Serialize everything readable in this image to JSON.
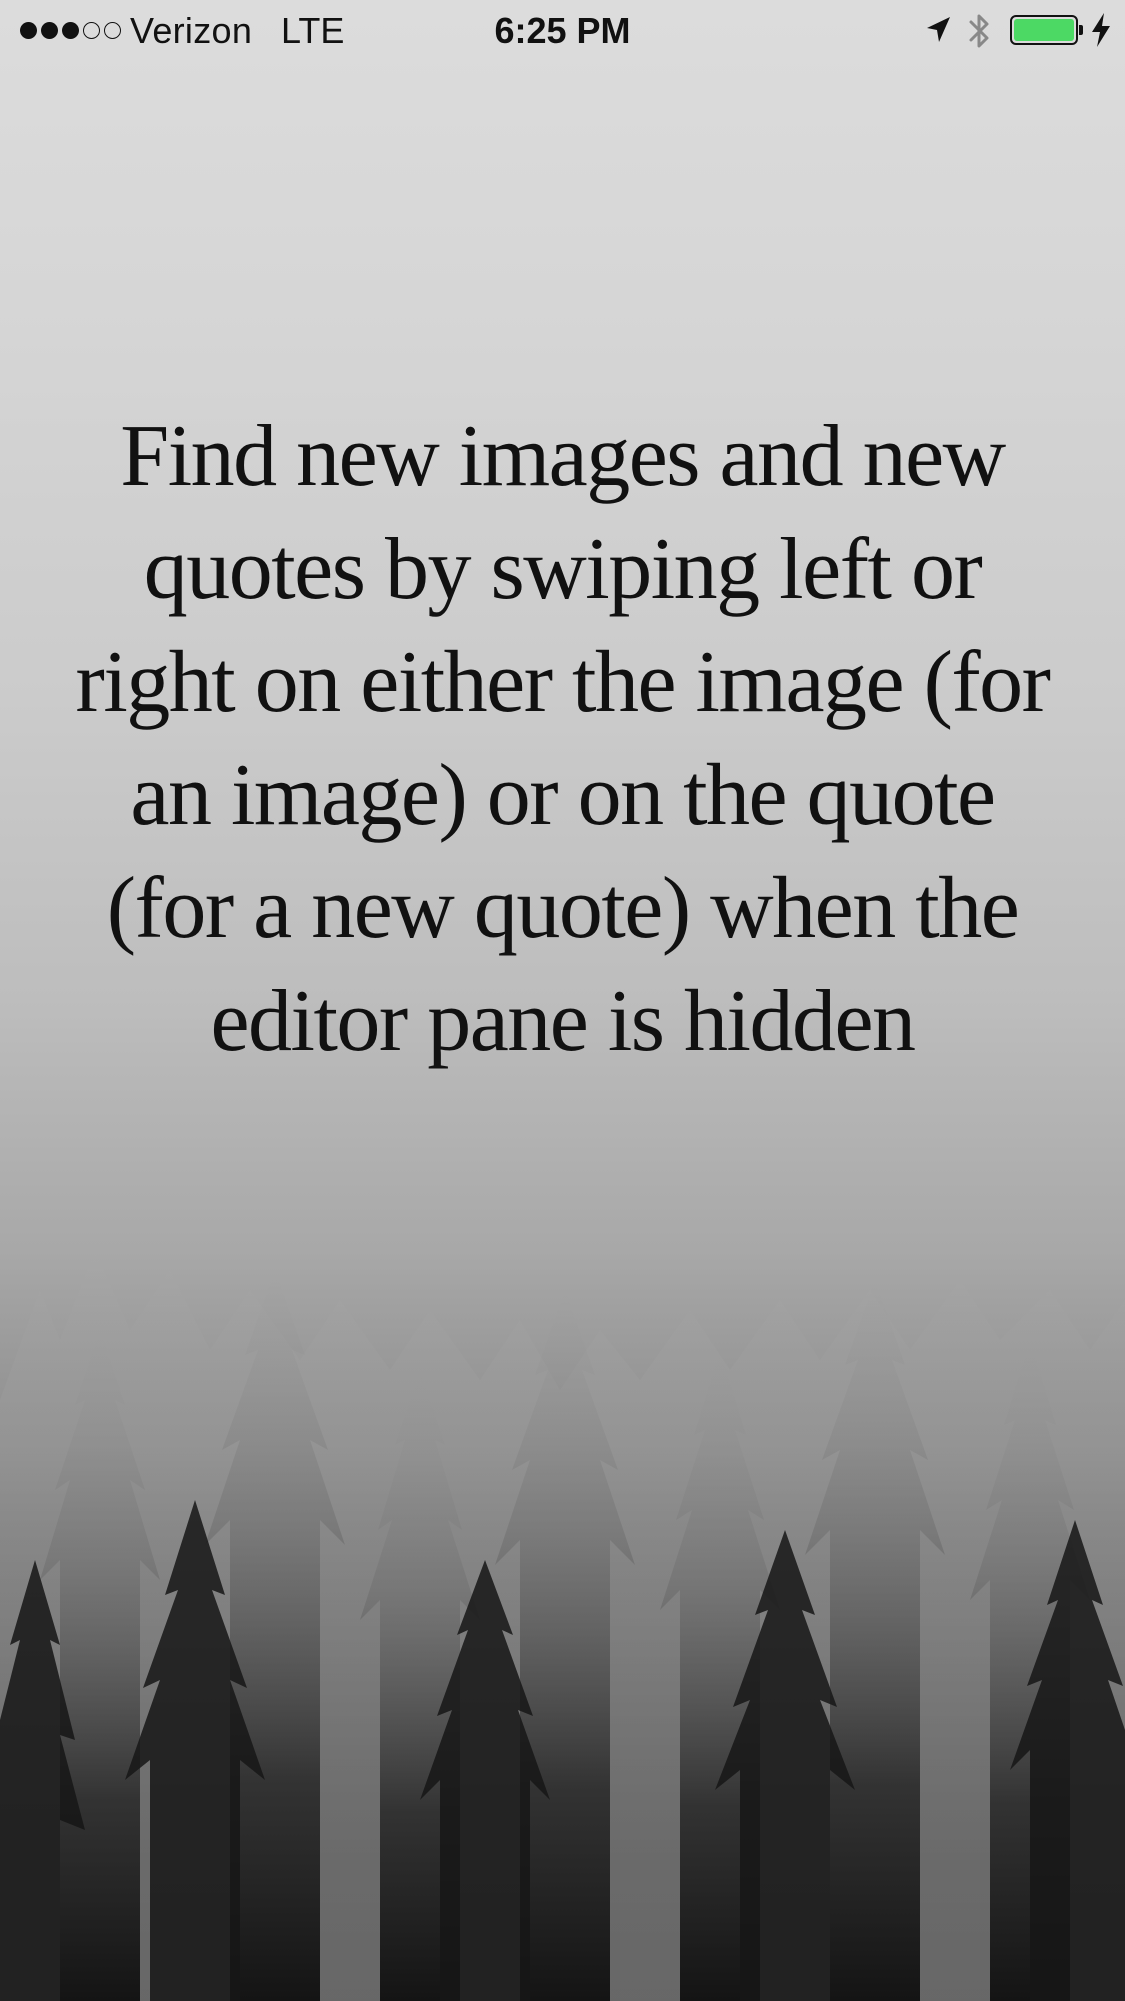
{
  "status_bar": {
    "signal": {
      "filled_bars": 3,
      "total_bars": 5
    },
    "carrier": "Verizon",
    "network": "LTE",
    "time": "6:25 PM",
    "icons": [
      "location-arrow-icon",
      "bluetooth-icon",
      "battery-icon",
      "charging-bolt-icon"
    ],
    "battery": {
      "level_percent": 100,
      "charging": true,
      "fill_color": "#4cd964"
    }
  },
  "background": {
    "description_icon": "foggy-forest-image",
    "colors": {
      "top": "#dcdcdc",
      "bottom": "#1c1c1c"
    }
  },
  "quote": {
    "text": "Find new images and new quotes by swiping left or right on either the image (for an image) or on the quote (for a new quote) when the editor pane is hidden",
    "color": "#111111"
  }
}
